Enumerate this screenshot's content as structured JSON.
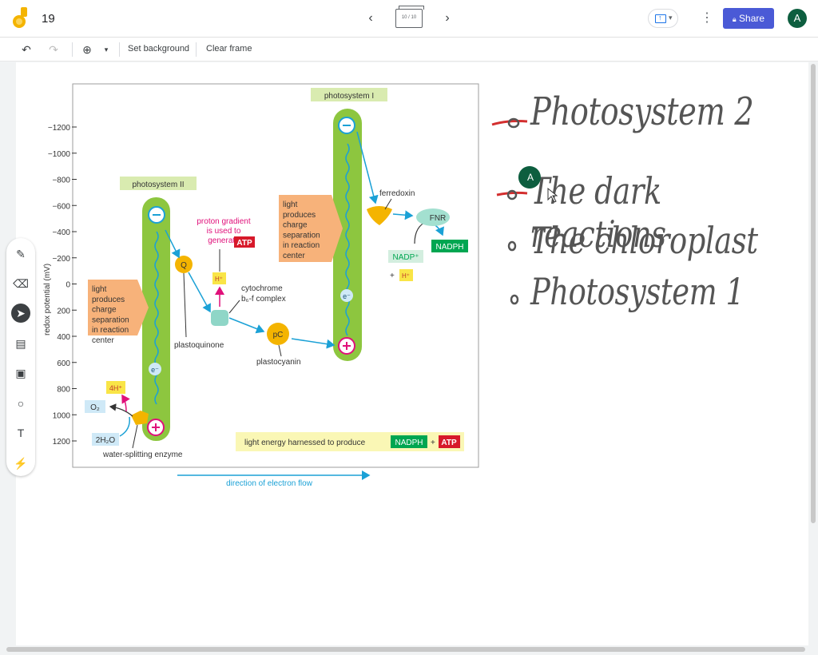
{
  "header": {
    "frame_number": "19",
    "frame_indicator": "10 / 10",
    "share_label": "Share",
    "user_initial": "A"
  },
  "toolbar": {
    "set_background": "Set background",
    "clear_frame": "Clear frame"
  },
  "diagram": {
    "y_axis_label": "redox potential (mV)",
    "y_ticks": [
      "−1200",
      "−1000",
      "−800",
      "−600",
      "−400",
      "−200",
      "0",
      "200",
      "400",
      "600",
      "800",
      "1000",
      "1200"
    ],
    "photosystem_ii": "photosystem II",
    "photosystem_i": "photosystem I",
    "light_text_1": [
      "light",
      "produces",
      "charge",
      "separation",
      "in reaction",
      "center"
    ],
    "light_text_2": [
      "light",
      "produces",
      "charge",
      "separation",
      "in reaction",
      "center"
    ],
    "proton_gradient": [
      "proton gradient",
      "is used to",
      "generate"
    ],
    "atp": "ATP",
    "h_plus": "H⁺",
    "cytochrome": [
      "cytochrome",
      "b₆-f complex"
    ],
    "plastoquinone": "plastoquinone",
    "plastocyanin": "plastocyanin",
    "q": "Q",
    "pc": "pC",
    "ferredoxin": "ferredoxin",
    "fnr": "FNR",
    "nadph": "NADPH",
    "nadp_plus": "NADP⁺",
    "plus_h": "+",
    "e_minus": "e⁻",
    "four_h": "4H⁺",
    "o2": "O₂",
    "water": "2H₂O",
    "water_enzyme": "water-splitting enzyme",
    "footer_text": "light energy harnessed to produce",
    "footer_nadph": "NADPH",
    "footer_plus": "+",
    "footer_atp": "ATP",
    "flow_label": "direction of electron flow"
  },
  "notes": {
    "item1": "Photosystem 2",
    "item2": "The dark reactions",
    "item3": "The chloroplast",
    "item4": "Photosystem 1",
    "cursor_initial": "A"
  },
  "colors": {
    "green_bar": "#8dc63f",
    "orange_box": "#f7b27a",
    "yellow": "#f4b400",
    "blue_arrow": "#1ba1d6",
    "magenta": "#e0107a",
    "share_blue": "#4a5ad6",
    "avatar_green": "#0d5e3f"
  }
}
